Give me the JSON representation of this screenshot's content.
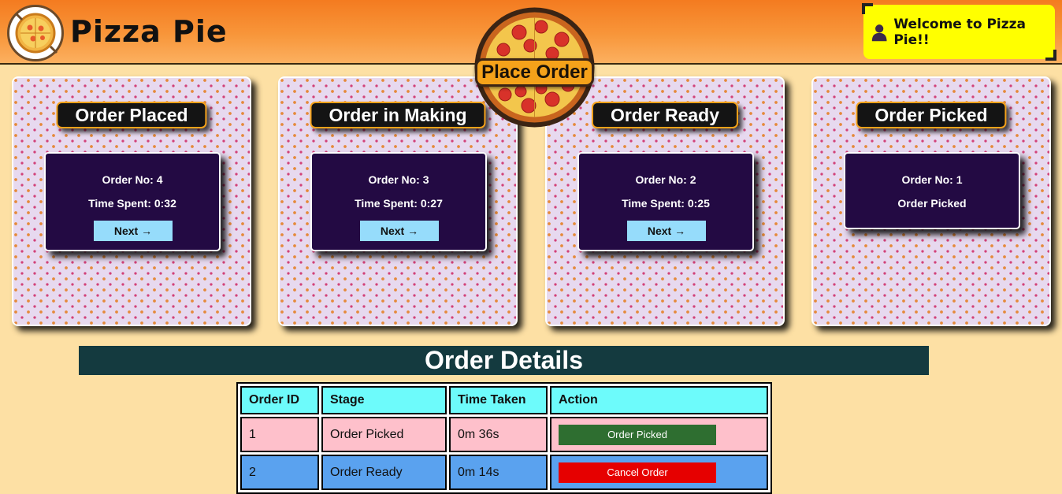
{
  "header": {
    "brand": "Pizza Pie",
    "welcome": "Welcome to Pizza Pie!!",
    "place_order": "Place Order"
  },
  "stages": [
    {
      "title": "Order Placed",
      "order_label": "Order No: 4",
      "info": "Time Spent: 0:32",
      "next_label": "Next →"
    },
    {
      "title": "Order in Making",
      "order_label": "Order No: 3",
      "info": "Time Spent: 0:27",
      "next_label": "Next →"
    },
    {
      "title": "Order Ready",
      "order_label": "Order No: 2",
      "info": "Time Spent: 0:25",
      "next_label": "Next →"
    },
    {
      "title": "Order Picked",
      "order_label": "Order No: 1",
      "info": "Order Picked"
    }
  ],
  "details": {
    "title": "Order Details",
    "columns": [
      "Order ID",
      "Stage",
      "Time Taken",
      "Action"
    ],
    "rows": [
      {
        "id": "1",
        "stage": "Order Picked",
        "time": "0m 36s",
        "action": "Order Picked",
        "action_color": "#2e6e30"
      },
      {
        "id": "2",
        "stage": "Order Ready",
        "time": "0m 14s",
        "action": "Cancel Order",
        "action_color": "#e60000"
      }
    ]
  },
  "colors": {
    "page_bg": "#fde0a4",
    "header_orange": "#f47b20",
    "welcome_bg": "#ffff00",
    "card_bg": "#230a43",
    "next_button": "#96dcfb",
    "details_header": "#143a3f",
    "table_header": "#6dfbfb",
    "row_picked": "#fec0cb",
    "row_ready": "#5aa2ef"
  }
}
